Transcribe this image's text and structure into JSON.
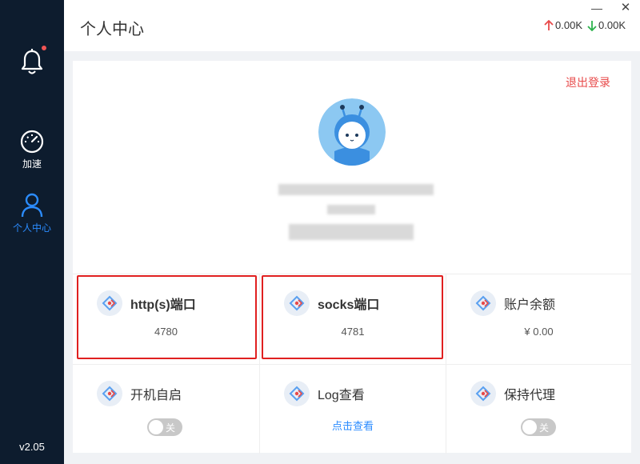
{
  "sidebar": {
    "items": [
      {
        "label": "加速"
      },
      {
        "label": "个人中心"
      }
    ],
    "version": "v2.05"
  },
  "header": {
    "title": "个人中心",
    "minimize": "—",
    "close": "✕",
    "upload_speed": "0.00K",
    "download_speed": "0.00K"
  },
  "profile": {
    "logout_label": "退出登录"
  },
  "cards": [
    {
      "title": "http(s)端口",
      "value": "4780",
      "icon": "proxy-icon"
    },
    {
      "title": "socks端口",
      "value": "4781",
      "icon": "proxy-icon"
    },
    {
      "title": "账户余额",
      "value": "¥ 0.00",
      "icon": "proxy-icon"
    },
    {
      "title": "开机自启",
      "toggle": "关",
      "icon": "proxy-icon"
    },
    {
      "title": "Log查看",
      "link": "点击查看",
      "icon": "proxy-icon"
    },
    {
      "title": "保持代理",
      "toggle": "关",
      "icon": "proxy-icon"
    }
  ],
  "colors": {
    "sidebar_bg": "#0d1c2e",
    "accent": "#2b8cff",
    "logout": "#e84a4a",
    "upload_arrow": "#e84a4a",
    "download_arrow": "#2bb24c",
    "highlight": "#e02020"
  }
}
